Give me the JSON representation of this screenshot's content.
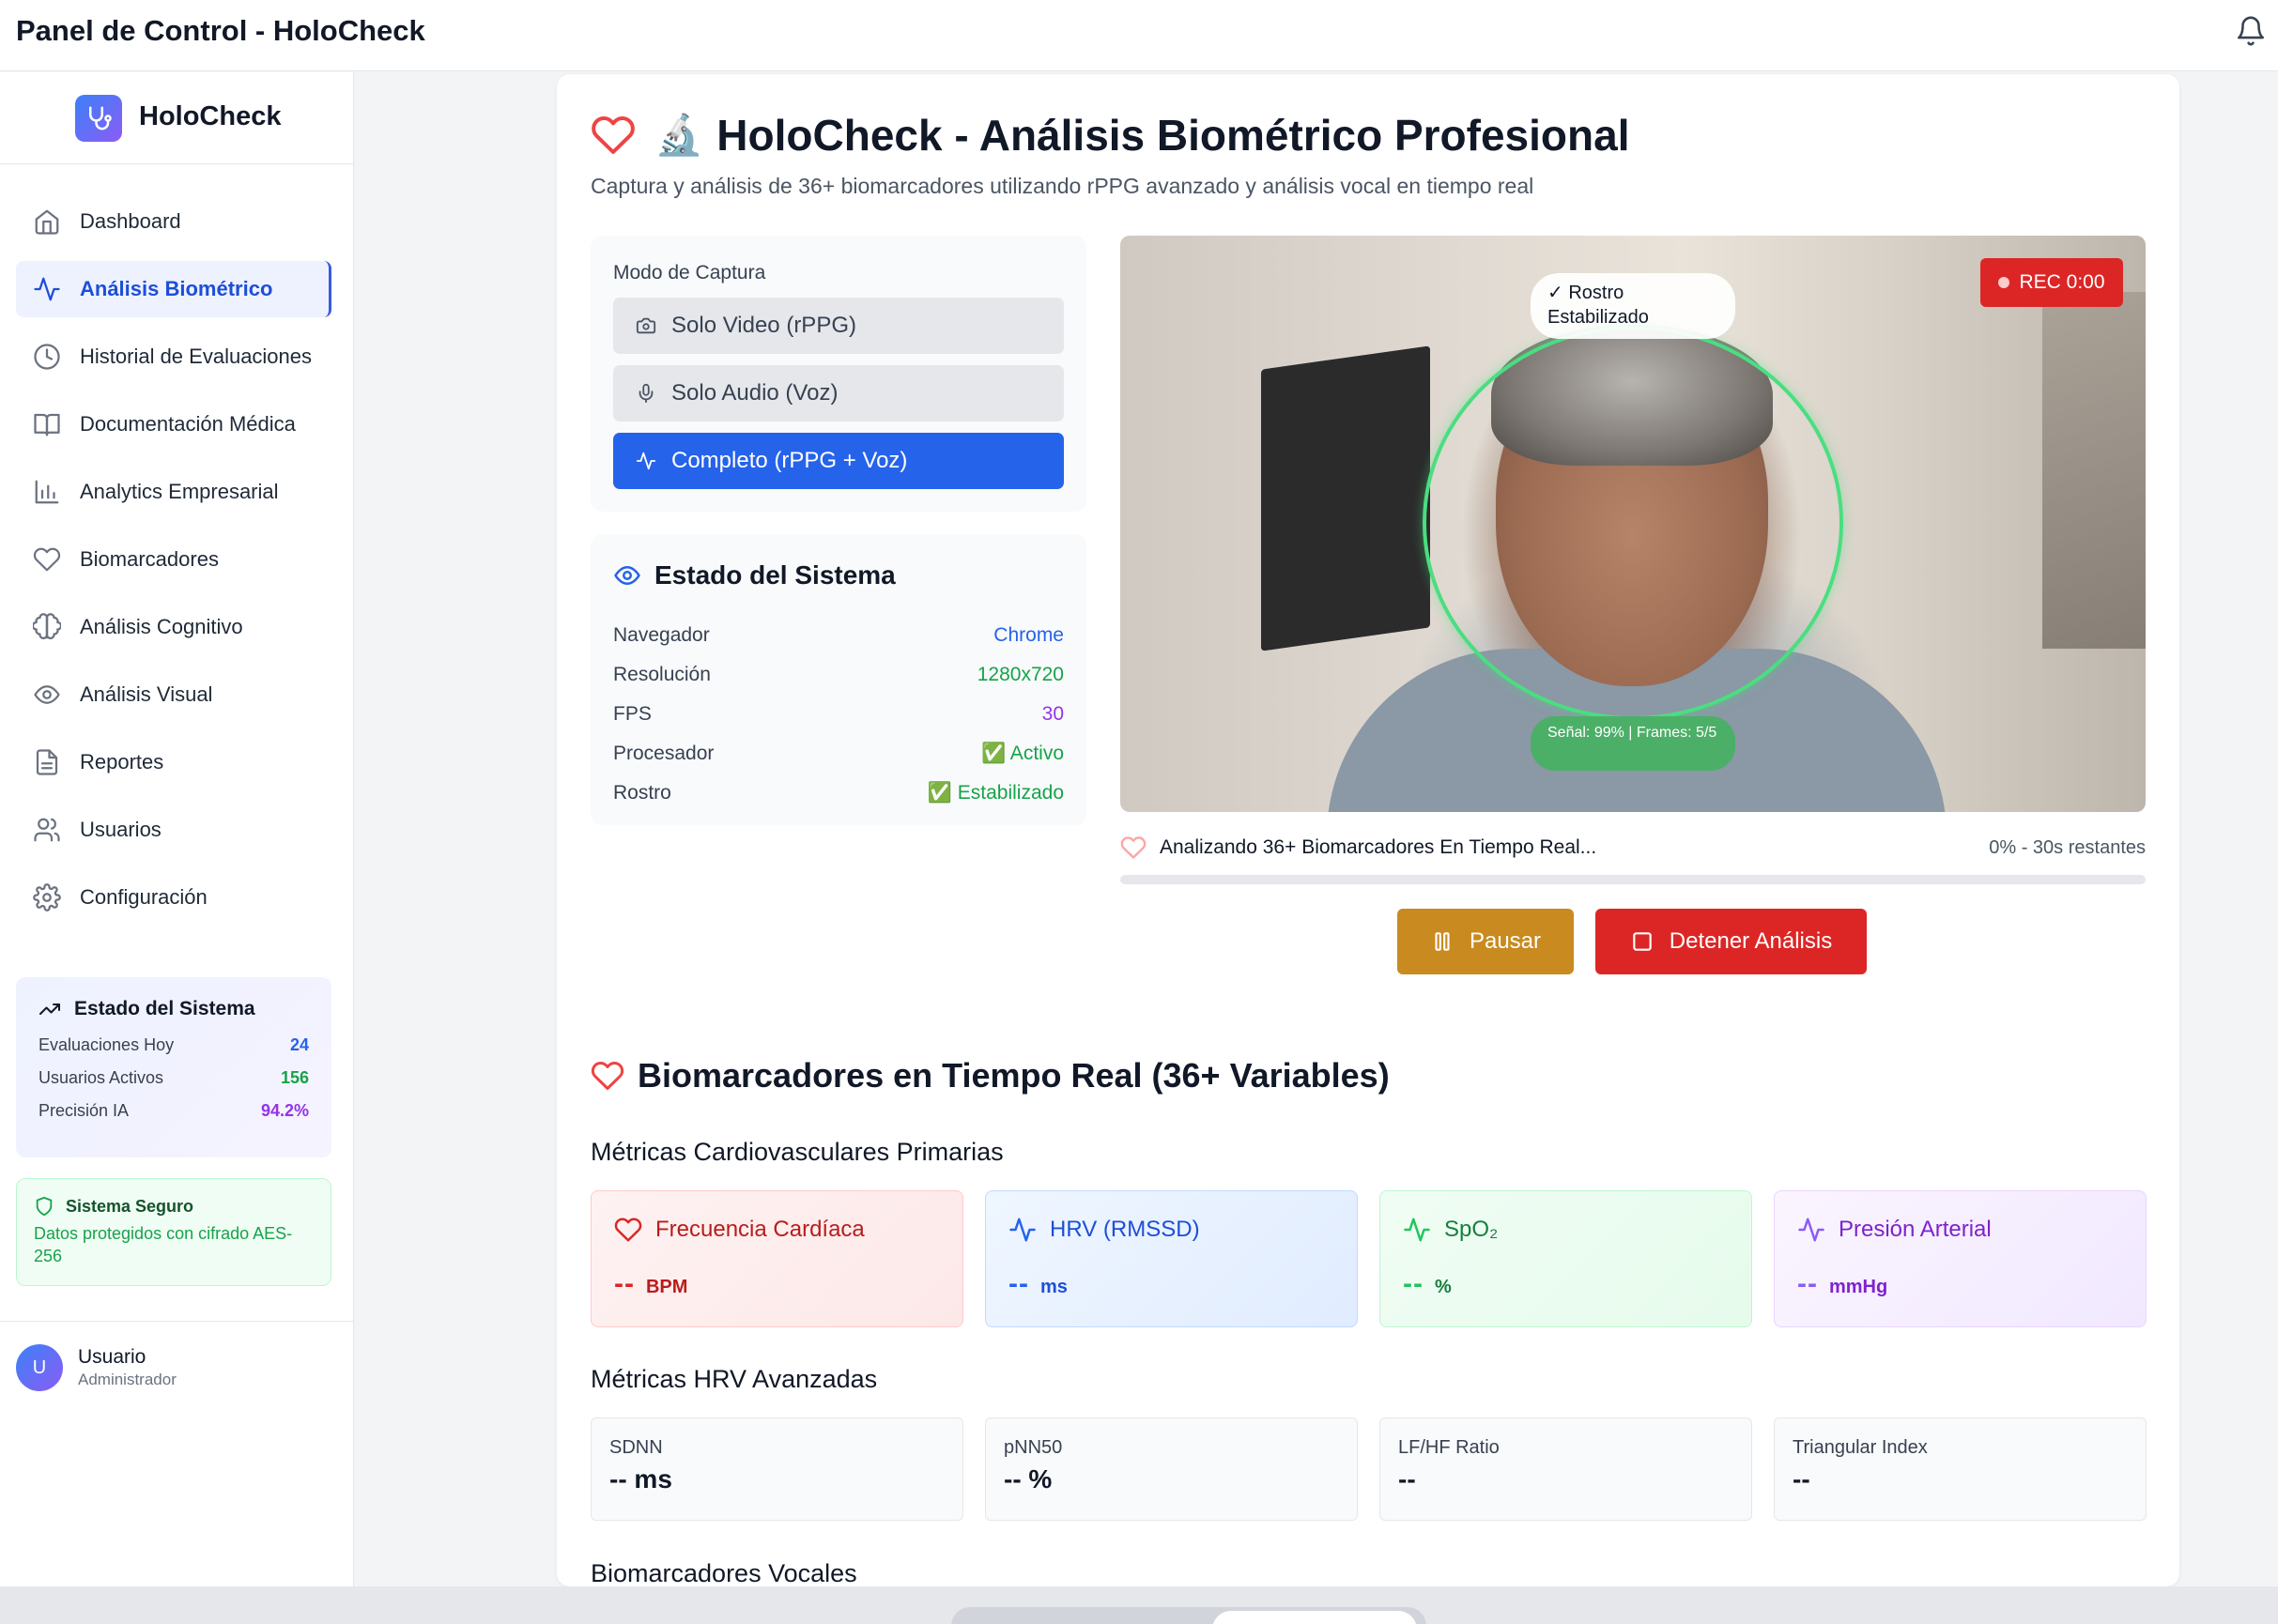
{
  "topbar": {
    "title": "Panel de Control - HoloCheck",
    "bell_icon": "bell-icon"
  },
  "sidebar": {
    "brand": "HoloCheck",
    "items": [
      {
        "label": "Dashboard",
        "icon": "home-icon"
      },
      {
        "label": "Análisis Biométrico",
        "icon": "activity-icon",
        "active": true
      },
      {
        "label": "Historial de Evaluaciones",
        "icon": "clock-icon"
      },
      {
        "label": "Documentación Médica",
        "icon": "book-icon"
      },
      {
        "label": "Analytics Empresarial",
        "icon": "bar-chart-icon"
      },
      {
        "label": "Biomarcadores",
        "icon": "heart-icon"
      },
      {
        "label": "Análisis Cognitivo",
        "icon": "brain-icon"
      },
      {
        "label": "Análisis Visual",
        "icon": "eye-icon"
      },
      {
        "label": "Reportes",
        "icon": "file-icon"
      },
      {
        "label": "Usuarios",
        "icon": "users-icon"
      },
      {
        "label": "Configuración",
        "icon": "gear-icon"
      }
    ],
    "status": {
      "title": "Estado del Sistema",
      "rows": [
        {
          "label": "Evaluaciones Hoy",
          "value": "24",
          "color": "#2563eb"
        },
        {
          "label": "Usuarios Activos",
          "value": "156",
          "color": "#16a34a"
        },
        {
          "label": "Precisión IA",
          "value": "94.2%",
          "color": "#9333ea"
        }
      ]
    },
    "secure": {
      "title": "Sistema Seguro",
      "text": "Datos protegidos con cifrado AES-256"
    },
    "user": {
      "initial": "U",
      "name": "Usuario",
      "role": "Administrador"
    }
  },
  "main": {
    "title_emoji": "🔬",
    "title": "HoloCheck - Análisis Biométrico Profesional",
    "subtitle": "Captura y análisis de 36+ biomarcadores utilizando rPPG avanzado y análisis vocal en tiempo real",
    "capture": {
      "title": "Modo de Captura",
      "modes": [
        {
          "label": "Solo Video (rPPG)",
          "icon": "camera-icon"
        },
        {
          "label": "Solo Audio (Voz)",
          "icon": "mic-icon"
        },
        {
          "label": "Completo (rPPG + Voz)",
          "icon": "activity-icon",
          "active": true
        }
      ]
    },
    "system": {
      "title": "Estado del Sistema",
      "rows": [
        {
          "label": "Navegador",
          "value": "Chrome",
          "color": "#2563eb"
        },
        {
          "label": "Resolución",
          "value": "1280x720",
          "color": "#16a34a"
        },
        {
          "label": "FPS",
          "value": "30",
          "color": "#9333ea"
        },
        {
          "label": "Procesador",
          "value": "✅ Activo",
          "color": "#16a34a"
        },
        {
          "label": "Rostro",
          "value": "✅ Estabilizado",
          "color": "#16a34a"
        }
      ]
    },
    "video": {
      "face_badge": "✓ Rostro Estabilizado",
      "signal_badge": "Señal: 99% | Frames: 5/5",
      "rec": "REC 0:00"
    },
    "analysis": {
      "label": "Analizando 36+ Biomarcadores En Tiempo Real...",
      "progress_text": "0% - 30s restantes",
      "progress": 0
    },
    "buttons": {
      "pause": "Pausar",
      "stop": "Detener Análisis"
    },
    "biomarkers_title": "Biomarcadores en Tiempo Real (36+ Variables)",
    "cardio_title": "Métricas Cardiovasculares Primarias",
    "cardio": [
      {
        "label": "Frecuencia Cardíaca",
        "value": "--",
        "unit": "BPM",
        "icon": "heart-icon",
        "theme": "red"
      },
      {
        "label": "HRV (RMSSD)",
        "value": "--",
        "unit": "ms",
        "icon": "activity-icon",
        "theme": "blue"
      },
      {
        "label": "SpO₂",
        "value": "--",
        "unit": "%",
        "icon": "activity-icon",
        "theme": "green"
      },
      {
        "label": "Presión Arterial",
        "value": "--",
        "unit": "mmHg",
        "icon": "activity-icon",
        "theme": "purple"
      }
    ],
    "hrv_title": "Métricas HRV Avanzadas",
    "hrv": [
      {
        "label": "SDNN",
        "value": "-- ms"
      },
      {
        "label": "pNN50",
        "value": "-- %"
      },
      {
        "label": "LF/HF Ratio",
        "value": "--"
      },
      {
        "label": "Triangular Index",
        "value": "--"
      }
    ],
    "vocal_title": "Biomarcadores Vocales"
  }
}
